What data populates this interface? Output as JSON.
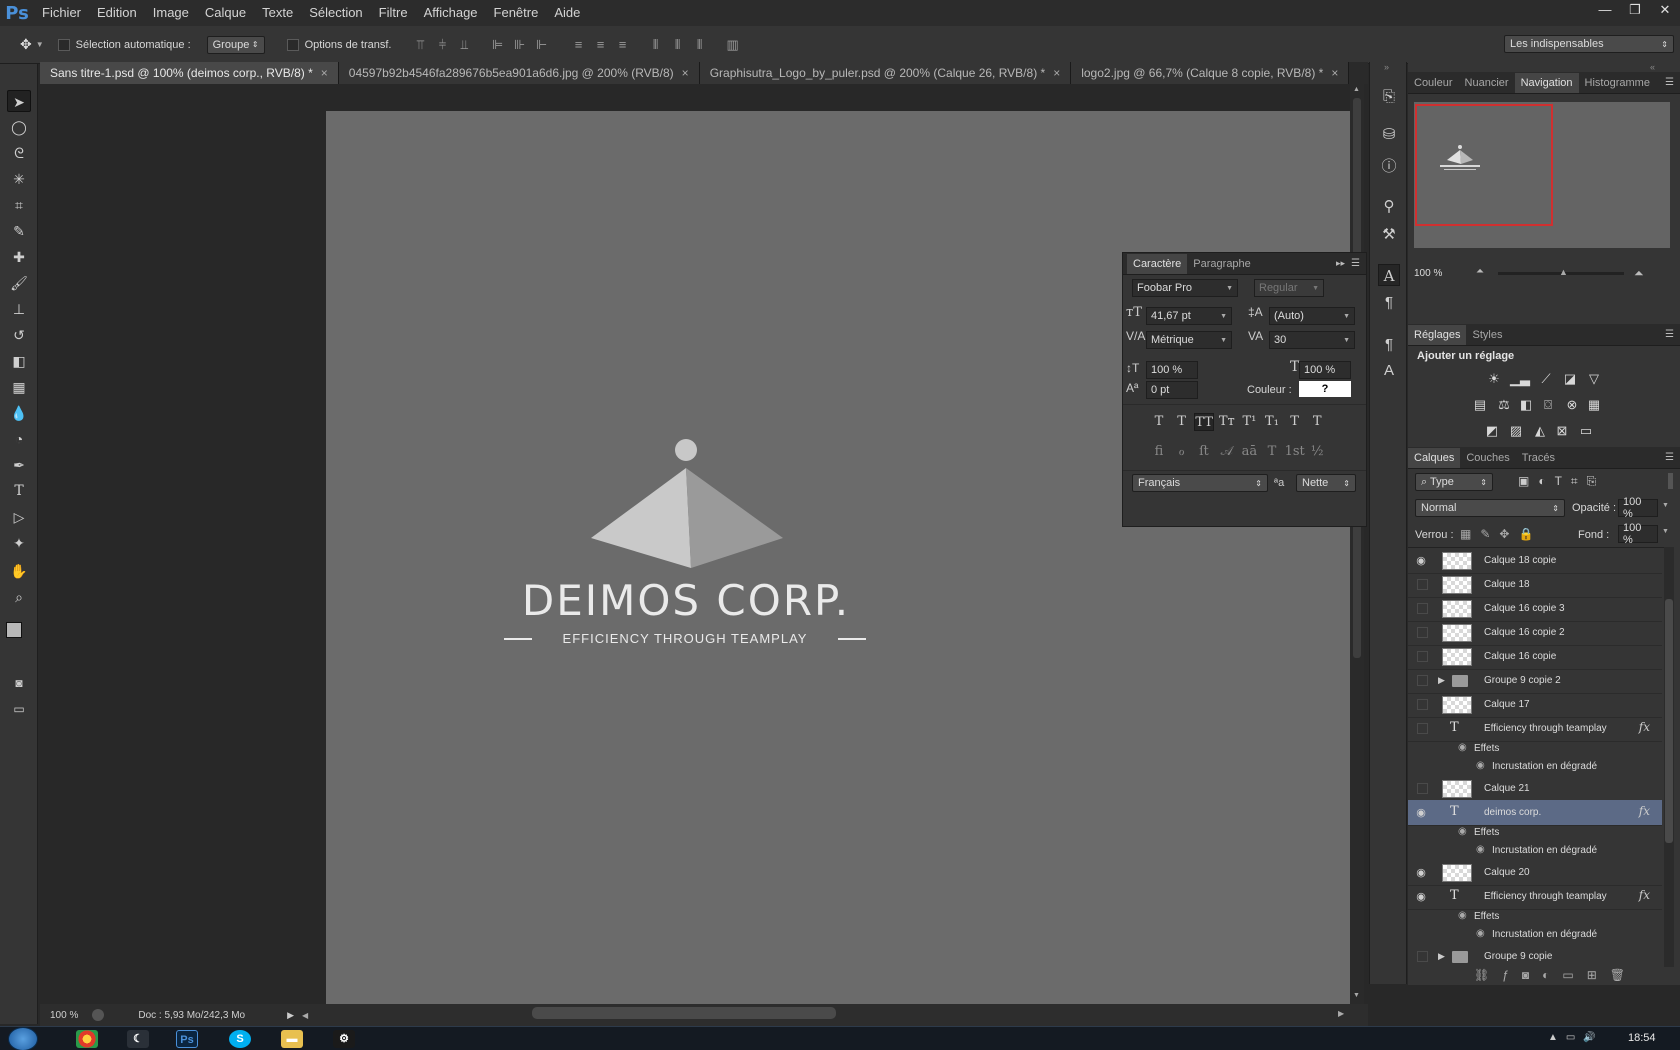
{
  "app": {
    "logo": "Ps"
  },
  "menu": [
    "Fichier",
    "Edition",
    "Image",
    "Calque",
    "Texte",
    "Sélection",
    "Filtre",
    "Affichage",
    "Fenêtre",
    "Aide"
  ],
  "window_controls": [
    "—",
    "❐",
    "✕"
  ],
  "options_bar": {
    "auto_select_label": "Sélection automatique :",
    "auto_select_value": "Groupe",
    "transform_label": "Options de transf.",
    "workspace": "Les indispensables"
  },
  "doc_tabs": [
    {
      "label": "Sans titre-1.psd @ 100% (deimos corp., RVB/8) *",
      "active": true
    },
    {
      "label": "04597b92b4546fa289676b5ea901a6d6.jpg @ 200% (RVB/8)",
      "active": false
    },
    {
      "label": "Graphisutra_Logo_by_puler.psd @ 200% (Calque 26, RVB/8) *",
      "active": false
    },
    {
      "label": "logo2.jpg @ 66,7% (Calque 8 copie, RVB/8) *",
      "active": false
    }
  ],
  "canvas_logo": {
    "title": "DEIMOS CORP.",
    "tagline": "EFFICIENCY THROUGH TEAMPLAY"
  },
  "status": {
    "zoom": "100 %",
    "doc": "Doc : 5,93 Mo/242,3 Mo"
  },
  "character_panel": {
    "tabs": [
      "Caractère",
      "Paragraphe"
    ],
    "font": "Foobar Pro",
    "style": "Regular",
    "size": "41,67 pt",
    "leading": "(Auto)",
    "kerning": "Métrique",
    "tracking": "30",
    "vscale": "100 %",
    "hscale": "100 %",
    "baseline": "0 pt",
    "color_label": "Couleur :",
    "color_value": "?",
    "format_buttons": [
      "T",
      "T",
      "TT",
      "Tт",
      "T¹",
      "T₁",
      "T",
      "T"
    ],
    "ot_buttons": [
      "ﬁ",
      "ℴ",
      "ﬅ",
      "𝒜",
      "aā",
      "T",
      "1st",
      "½"
    ],
    "language": "Français",
    "aa_icon": "ªa",
    "antialias": "Nette"
  },
  "nav_panel": {
    "tabs": [
      "Couleur",
      "Nuancier",
      "Navigation",
      "Histogramme"
    ],
    "zoom": "100 %"
  },
  "adjust_panel": {
    "tabs": [
      "Réglages",
      "Styles"
    ],
    "title": "Ajouter un réglage"
  },
  "layers_panel": {
    "tabs": [
      "Calques",
      "Couches",
      "Tracés"
    ],
    "filter": "Type",
    "blend": "Normal",
    "opacity_label": "Opacité :",
    "opacity": "100 %",
    "lock_label": "Verrou :",
    "fill_label": "Fond :",
    "fill": "100 %",
    "layers": [
      {
        "name": "Calque 18 copie",
        "kind": "pixel",
        "visible": true
      },
      {
        "name": "Calque 18",
        "kind": "pixel",
        "visible": false
      },
      {
        "name": "Calque 16 copie 3",
        "kind": "pixel",
        "visible": false
      },
      {
        "name": "Calque 16 copie 2",
        "kind": "pixel",
        "visible": false
      },
      {
        "name": "Calque 16 copie",
        "kind": "pixel",
        "visible": false
      },
      {
        "name": "Groupe 9 copie 2",
        "kind": "group",
        "visible": false
      },
      {
        "name": "Calque 17",
        "kind": "pixel",
        "visible": false
      },
      {
        "name": "Efficiency through teamplay",
        "kind": "text",
        "visible": false,
        "fx": true
      },
      {
        "name": "Effets",
        "kind": "effects"
      },
      {
        "name": "Incrustation en dégradé",
        "kind": "effect"
      },
      {
        "name": "Calque 21",
        "kind": "pixel",
        "visible": false
      },
      {
        "name": "deimos corp.",
        "kind": "text",
        "visible": true,
        "fx": true,
        "selected": true
      },
      {
        "name": "Effets",
        "kind": "effects"
      },
      {
        "name": "Incrustation en dégradé",
        "kind": "effect"
      },
      {
        "name": "Calque 20",
        "kind": "pixel",
        "visible": true
      },
      {
        "name": "Efficiency through teamplay",
        "kind": "text",
        "visible": true,
        "fx": true
      },
      {
        "name": "Effets",
        "kind": "effects"
      },
      {
        "name": "Incrustation en dégradé",
        "kind": "effect"
      },
      {
        "name": "Groupe 9 copie",
        "kind": "group",
        "visible": false
      }
    ]
  },
  "taskbar": {
    "clock": "18:54"
  }
}
